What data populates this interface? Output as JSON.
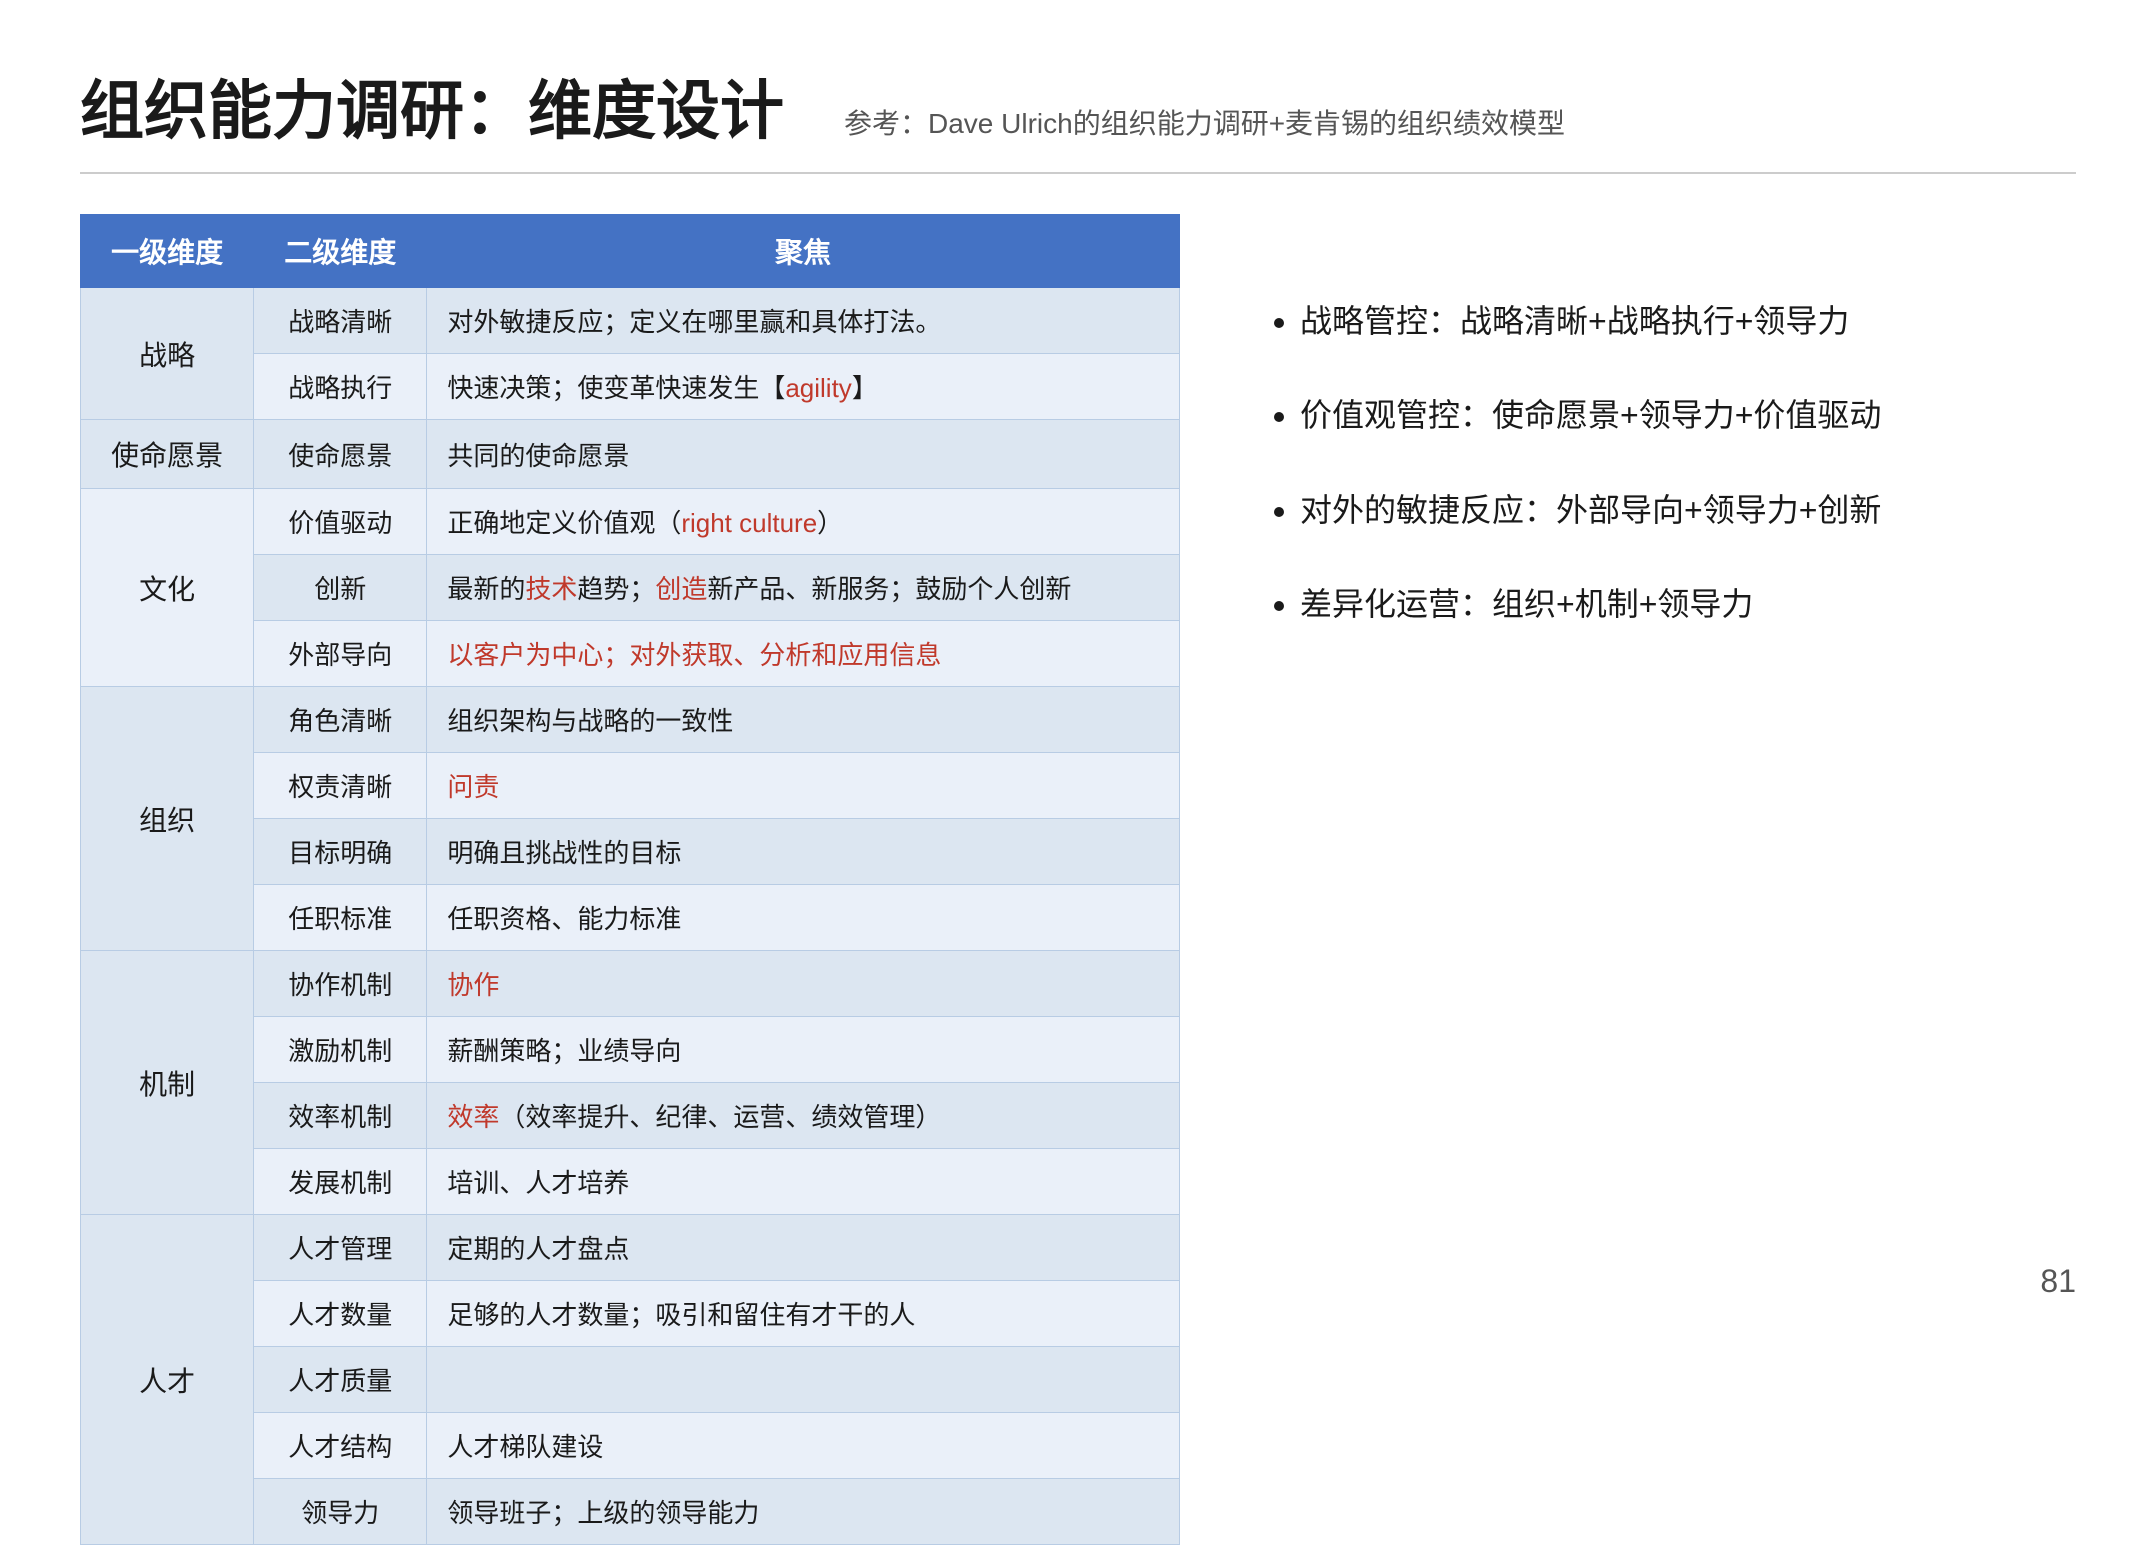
{
  "header": {
    "title": "组织能力调研：维度设计",
    "reference": "参考：Dave Ulrich的组织能力调研+麦肯锡的组织绩效模型"
  },
  "table": {
    "columns": [
      "一级维度",
      "二级维度",
      "聚焦"
    ],
    "rows": [
      {
        "level1": "战略",
        "level2": "战略清晰",
        "focus": "对外敏捷反应；定义在哪里赢和具体打法。",
        "focus_parts": [
          {
            "text": "对外敏捷反应；定义在哪里赢和具体打法。",
            "color": "normal"
          }
        ]
      },
      {
        "level1": "",
        "level2": "战略执行",
        "focus": "快速决策；使变革快速发生【agility】",
        "focus_parts": [
          {
            "text": "快速决策；使变革快速发生【",
            "color": "normal"
          },
          {
            "text": "agility",
            "color": "red"
          },
          {
            "text": "】",
            "color": "normal"
          }
        ]
      },
      {
        "level1": "使命愿景",
        "level2": "使命愿景",
        "focus": "共同的使命愿景",
        "focus_parts": [
          {
            "text": "共同的使命愿景",
            "color": "normal"
          }
        ]
      },
      {
        "level1": "文化",
        "level2": "价值驱动",
        "focus": "正确地定义价值观（right culture）",
        "focus_parts": [
          {
            "text": "正确地定义价值观（",
            "color": "normal"
          },
          {
            "text": "right culture",
            "color": "red"
          },
          {
            "text": "）",
            "color": "normal"
          }
        ]
      },
      {
        "level1": "",
        "level2": "创新",
        "focus": "最新的技术趋势；创造新产品、新服务；鼓励个人创新",
        "focus_parts": [
          {
            "text": "最新的",
            "color": "normal"
          },
          {
            "text": "技术",
            "color": "red"
          },
          {
            "text": "趋势；",
            "color": "normal"
          },
          {
            "text": "创造",
            "color": "red"
          },
          {
            "text": "新产品、新服务；鼓励个人创新",
            "color": "normal"
          }
        ]
      },
      {
        "level1": "",
        "level2": "外部导向",
        "focus": "以客户为中心；对外获取、分析和应用信息",
        "focus_parts": [
          {
            "text": "以客户为中心；对外",
            "color": "red"
          },
          {
            "text": "获取、分析和应用信息",
            "color": "red"
          }
        ]
      },
      {
        "level1": "组织",
        "level2": "角色清晰",
        "focus": "组织架构与战略的一致性",
        "focus_parts": [
          {
            "text": "组织架构与战略的一致性",
            "color": "normal"
          }
        ]
      },
      {
        "level1": "",
        "level2": "权责清晰",
        "focus": "问责",
        "focus_parts": [
          {
            "text": "问责",
            "color": "red"
          }
        ]
      },
      {
        "level1": "",
        "level2": "目标明确",
        "focus": "明确且挑战性的目标",
        "focus_parts": [
          {
            "text": "明确且挑战性的目标",
            "color": "normal"
          }
        ]
      },
      {
        "level1": "",
        "level2": "任职标准",
        "focus": "任职资格、能力标准",
        "focus_parts": [
          {
            "text": "任职资格、能力标准",
            "color": "normal"
          }
        ]
      },
      {
        "level1": "机制",
        "level2": "协作机制",
        "focus": "协作",
        "focus_parts": [
          {
            "text": "协作",
            "color": "red"
          }
        ]
      },
      {
        "level1": "",
        "level2": "激励机制",
        "focus": "薪酬策略；业绩导向",
        "focus_parts": [
          {
            "text": "薪酬策略；业绩导向",
            "color": "normal"
          }
        ]
      },
      {
        "level1": "",
        "level2": "效率机制",
        "focus": "效率（效率提升、纪律、运营、绩效管理）",
        "focus_parts": [
          {
            "text": "效率",
            "color": "red"
          },
          {
            "text": "（效率提升、纪律、运营、绩效管理）",
            "color": "normal"
          }
        ]
      },
      {
        "level1": "",
        "level2": "发展机制",
        "focus": "培训、人才培养",
        "focus_parts": [
          {
            "text": "培训、人才培养",
            "color": "normal"
          }
        ]
      },
      {
        "level1": "人才",
        "level2": "人才管理",
        "focus": "定期的人才盘点",
        "focus_parts": [
          {
            "text": "定期的人才盘点",
            "color": "normal"
          }
        ]
      },
      {
        "level1": "",
        "level2": "人才数量",
        "focus": "足够的人才数量；吸引和留住有才干的人",
        "focus_parts": [
          {
            "text": "足够的人才数量；吸引和留住有才干的人",
            "color": "normal"
          }
        ]
      },
      {
        "level1": "",
        "level2": "人才质量",
        "focus": "",
        "focus_parts": [
          {
            "text": "",
            "color": "normal"
          }
        ]
      },
      {
        "level1": "",
        "level2": "人才结构",
        "focus": "人才梯队建设",
        "focus_parts": [
          {
            "text": "人才梯队建设",
            "color": "normal"
          }
        ]
      },
      {
        "level1": "",
        "level2": "领导力",
        "focus": "领导班子；上级的领导能力",
        "focus_parts": [
          {
            "text": "领导班子；上级的领导能力",
            "color": "normal"
          }
        ]
      }
    ]
  },
  "sidebar": {
    "bullets": [
      "战略管控：战略清晰+战略执行+领导力",
      "价值观管控：使命愿景+领导力+价值驱动",
      "对外的敏捷反应：外部导向+领导力+创新",
      "差异化运营：组织+机制+领导力"
    ]
  },
  "page_number": "81"
}
